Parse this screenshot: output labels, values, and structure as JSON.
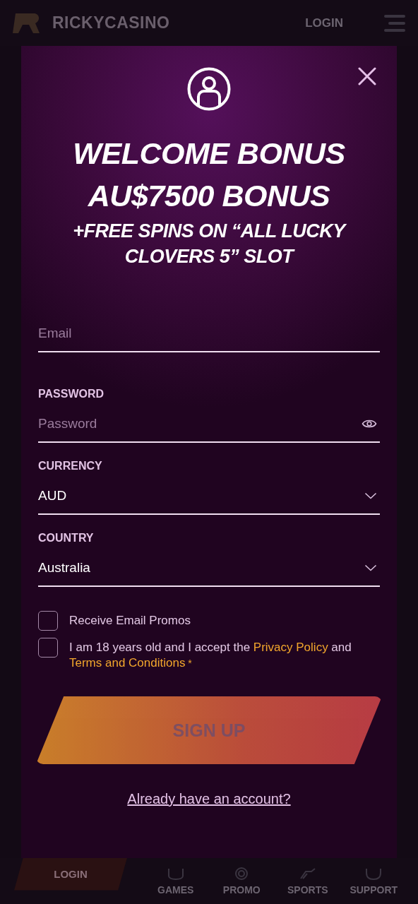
{
  "header": {
    "logo_text": "RICKYCASINO",
    "login": "LOGIN"
  },
  "modal": {
    "headline": [
      "WELCOME BONUS",
      "AU$7500 BONUS"
    ],
    "subheadline": "+FREE SPINS ON “ALL LUCKY CLOVERS 5” SLOT",
    "fields": [
      {
        "kind": "text",
        "placeholder": "Email"
      },
      {
        "kind": "password",
        "label": "PASSWORD",
        "placeholder": "Password"
      },
      {
        "kind": "select",
        "label": "CURRENCY",
        "value": "AUD"
      },
      {
        "kind": "select",
        "label": "COUNTRY",
        "value": "Australia"
      }
    ],
    "checkboxes": [
      {
        "checked": false,
        "segments": [
          {
            "kind": "text",
            "text": "Receive Email Promos"
          }
        ]
      },
      {
        "checked": false,
        "segments": [
          {
            "kind": "text",
            "text": "I am 18 years old and I accept the "
          },
          {
            "kind": "link",
            "text": "Privacy Policy"
          },
          {
            "kind": "text",
            "text": " and "
          },
          {
            "kind": "link",
            "text": "Terms and Conditions"
          },
          {
            "kind": "mark",
            "text": " *"
          }
        ]
      }
    ],
    "submit": {
      "label": "SIGN UP",
      "disabled": true
    },
    "login_link": "Already have an account?"
  },
  "bottom_nav": {
    "login": "LOGIN",
    "items": [
      {
        "label": "GAMES"
      },
      {
        "label": "PROMO"
      },
      {
        "label": "SPORTS"
      },
      {
        "label": "SUPPORT"
      }
    ]
  }
}
